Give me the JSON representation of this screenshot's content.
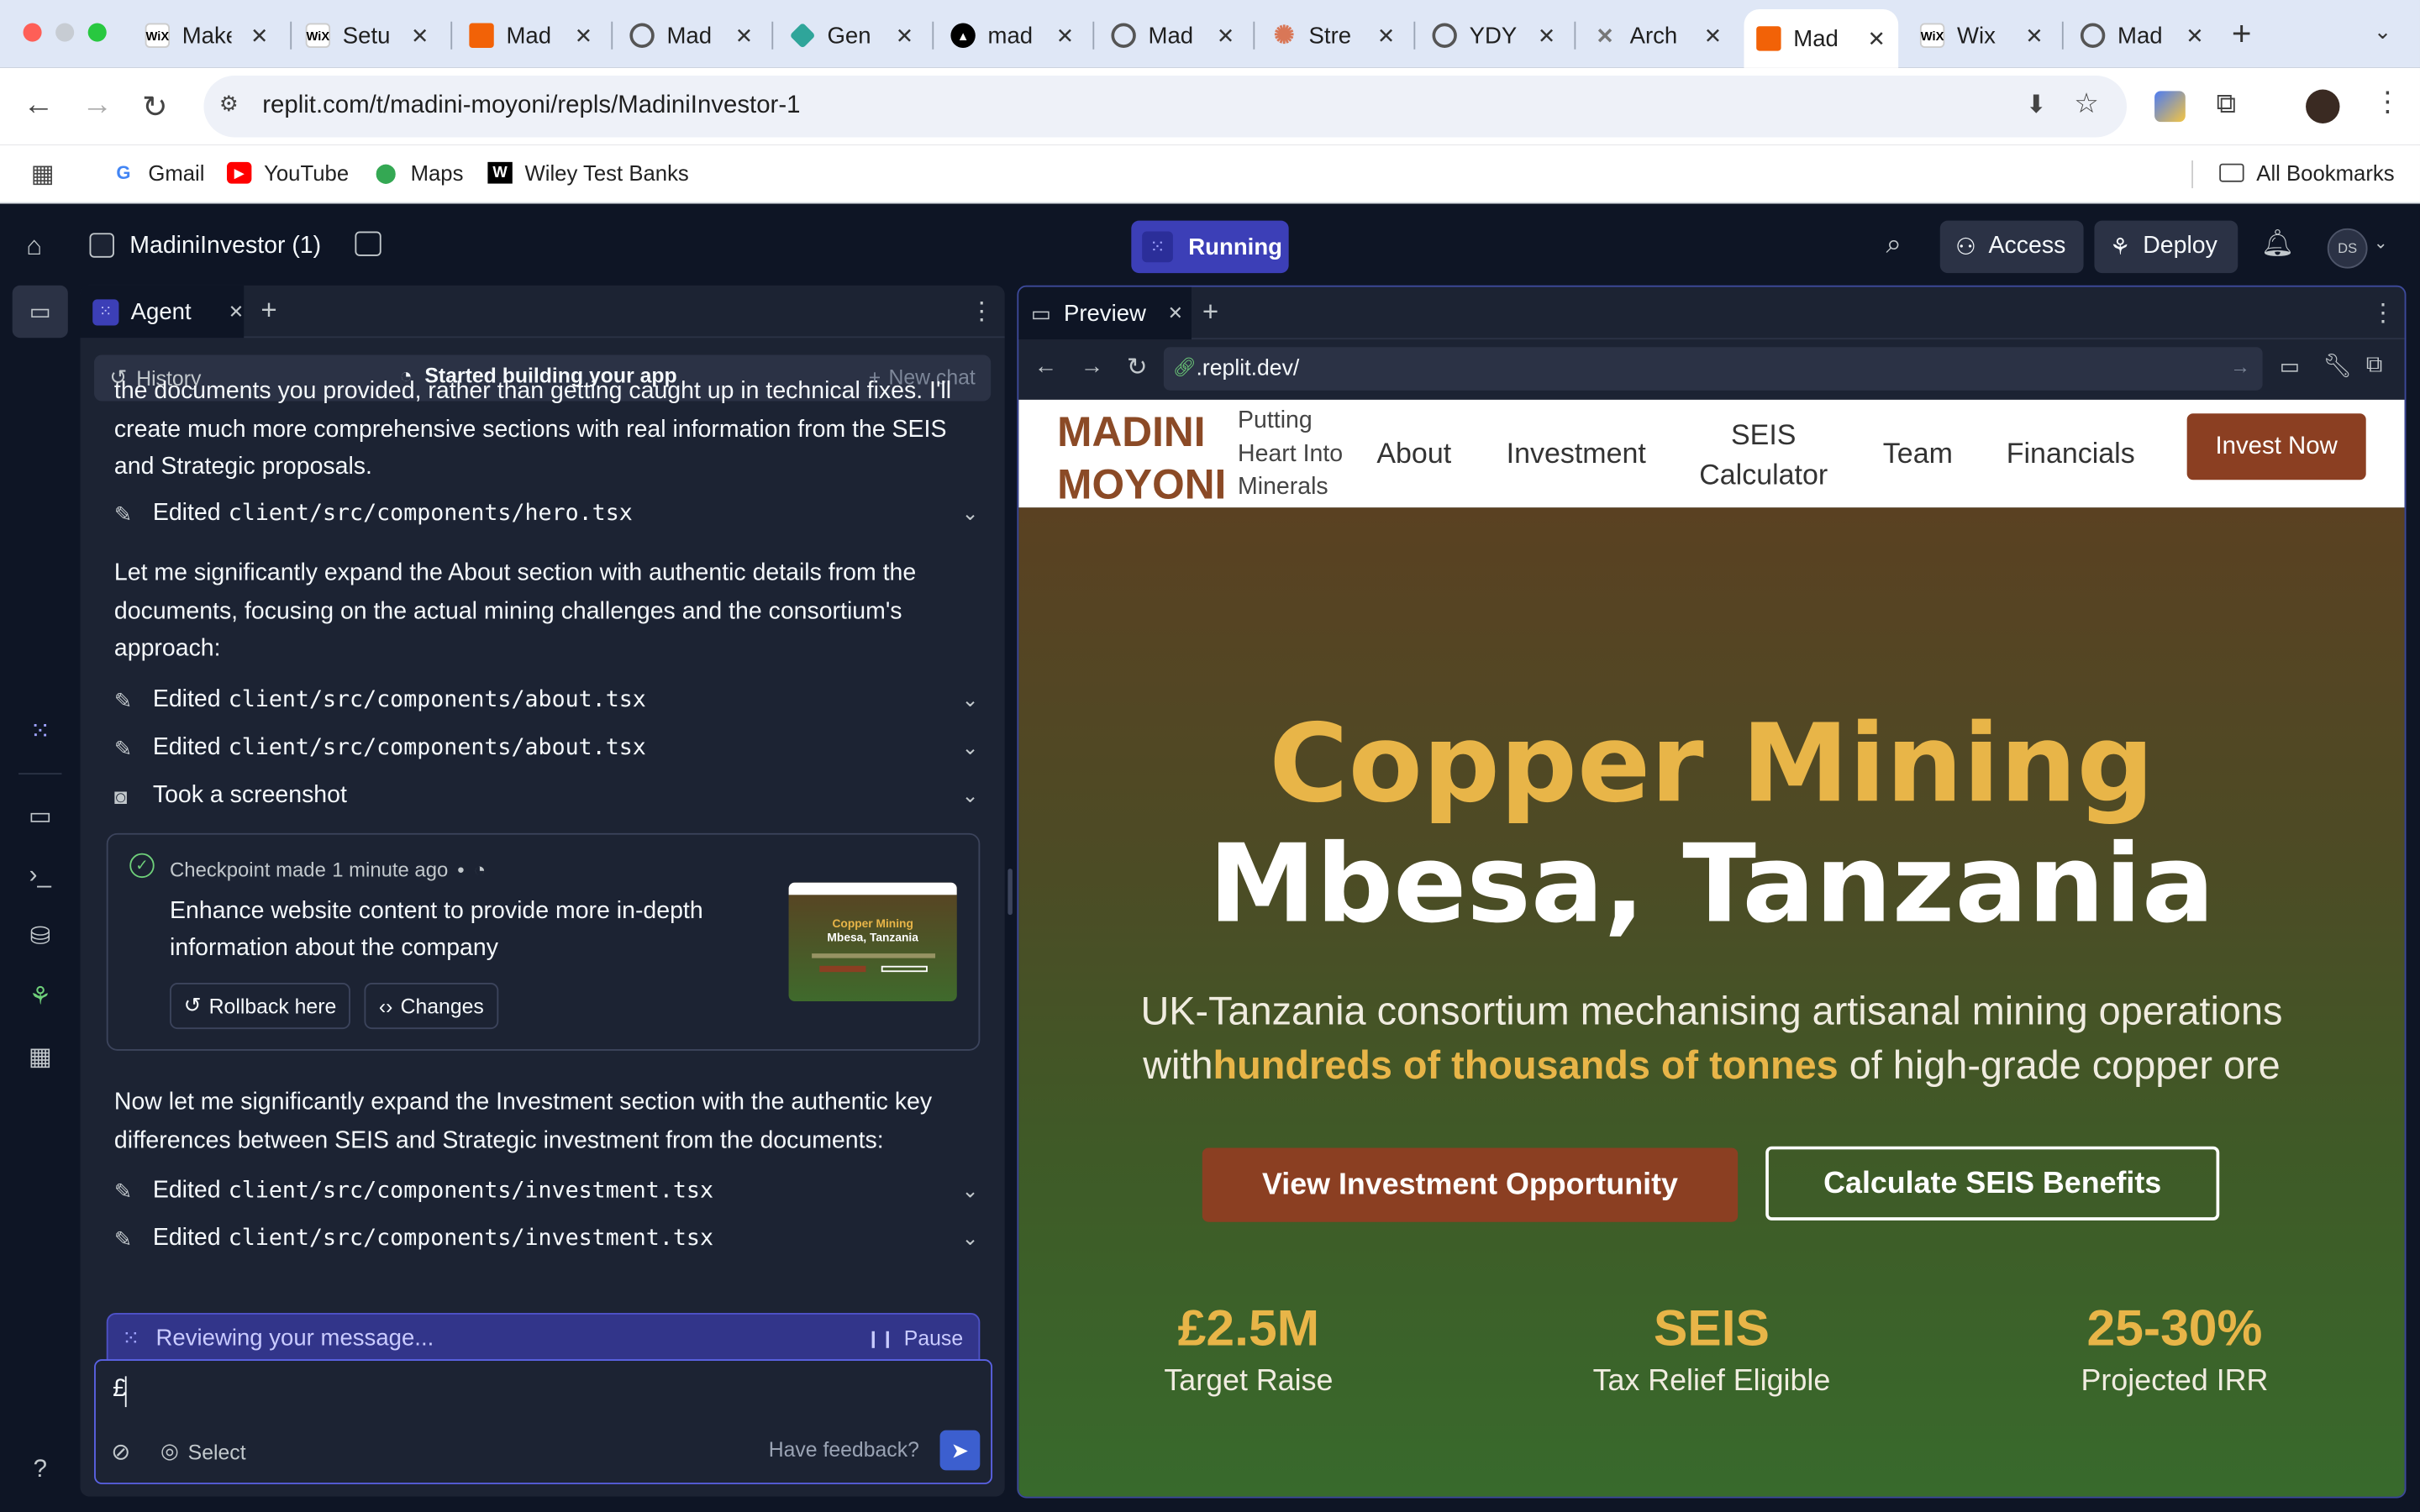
{
  "browser": {
    "tabs": [
      {
        "label": "Make",
        "icon": "wix-icon"
      },
      {
        "label": "Setu",
        "icon": "wix-icon"
      },
      {
        "label": "Mad",
        "icon": "replit-icon"
      },
      {
        "label": "Mad",
        "icon": "globe-icon"
      },
      {
        "label": "Gen",
        "icon": "diamond-icon"
      },
      {
        "label": "mad",
        "icon": "triangle-icon"
      },
      {
        "label": "Mad",
        "icon": "globe-icon"
      },
      {
        "label": "Stre",
        "icon": "claude-icon"
      },
      {
        "label": "YDY",
        "icon": "globe-icon"
      },
      {
        "label": "Arch",
        "icon": "archive-icon"
      },
      {
        "label": "Mad",
        "icon": "replit-icon",
        "active": true
      },
      {
        "label": "Wix",
        "icon": "wix-icon"
      },
      {
        "label": "Mad",
        "icon": "globe-icon"
      }
    ],
    "url": "replit.com/t/madini-moyoni/repls/MadiniInvestor-1",
    "bookmarks": [
      "Gmail",
      "YouTube",
      "Maps",
      "Wiley Test Banks"
    ],
    "all_bookmarks": "All Bookmarks",
    "avatar_initials": "DS"
  },
  "replit": {
    "project_name": "MadiniInvestor (1)",
    "status": "Running",
    "access_label": "Access",
    "deploy_label": "Deploy",
    "user_initials": "DS",
    "colors": {
      "accent": "#3c3fb7",
      "bg": "#0e1525",
      "panel": "#1c2333"
    }
  },
  "agent": {
    "tab_label": "Agent",
    "history_label": "History",
    "status_text": "Started building your app",
    "new_chat_label": "New chat",
    "para1": "the documents you provided, rather than getting caught up in technical fixes. I'll create much more comprehensive sections with real information from the SEIS and Strategic proposals.",
    "edit_hero": {
      "verb": "Edited",
      "file": "client/src/components/hero.tsx"
    },
    "para2": "Let me significantly expand the About section with authentic details from the documents, focusing on the actual mining challenges and the consortium's approach:",
    "edit_about1": {
      "verb": "Edited",
      "file": "client/src/components/about.tsx"
    },
    "edit_about2": {
      "verb": "Edited",
      "file": "client/src/components/about.tsx"
    },
    "screenshot_label": "Took a screenshot",
    "checkpoint": {
      "title": "Checkpoint made",
      "time": "1 minute ago",
      "description": "Enhance website content to provide more in-depth information about the company",
      "rollback_label": "Rollback here",
      "changes_label": "Changes",
      "thumb_title1": "Copper Mining",
      "thumb_title2": "Mbesa, Tanzania"
    },
    "para3": "Now let me significantly expand the Investment section with the authentic key differences between SEIS and Strategic investment from the documents:",
    "edit_inv1": {
      "verb": "Edited",
      "file": "client/src/components/investment.tsx"
    },
    "edit_inv2": {
      "verb": "Edited",
      "file": "client/src/components/investment.tsx"
    },
    "reviewing_text": "Reviewing your message...",
    "pause_label": "Pause",
    "input_value": "£",
    "select_label": "Select",
    "feedback_label": "Have feedback?"
  },
  "preview": {
    "tab_label": "Preview",
    "url": ".replit.dev/",
    "site": {
      "logo_line1": "MADINI",
      "logo_line2": "MOYONI",
      "tagline": [
        "Putting",
        "Heart Into",
        "Minerals"
      ],
      "nav": [
        "About",
        "Investment",
        "SEIS Calculator",
        "Team",
        "Financials"
      ],
      "nav_calc_line1": "SEIS",
      "nav_calc_line2": "Calculator",
      "cta": "Invest Now",
      "hero_title1": "Copper Mining",
      "hero_title2": "Mbesa, Tanzania",
      "hero_sub_line1": "UK-Tanzania consortium mechanising artisanal mining operations",
      "hero_sub_pre": "with",
      "hero_sub_highlight": "hundreds of thousands of tonnes",
      "hero_sub_post": " of high-grade copper ore",
      "btn_primary": "View Investment Opportunity",
      "btn_secondary": "Calculate SEIS Benefits",
      "stats": [
        {
          "value": "£2.5M",
          "label": "Target Raise"
        },
        {
          "value": "SEIS",
          "label": "Tax Relief Eligible"
        },
        {
          "value": "25-30%",
          "label": "Projected IRR"
        }
      ],
      "colors": {
        "gold": "#e8b548",
        "brown": "#8b3f22",
        "logo": "#8b4a26"
      }
    }
  }
}
